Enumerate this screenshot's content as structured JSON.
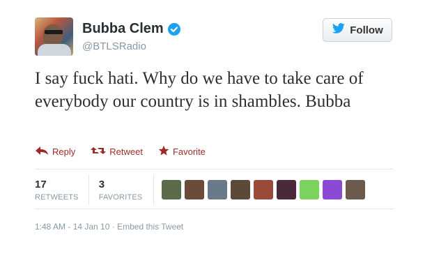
{
  "user": {
    "display_name": "Bubba Clem",
    "handle": "@BTLSRadio",
    "verified": true
  },
  "follow_button": {
    "label": "Follow",
    "icon": "twitter-bird-icon"
  },
  "tweet": {
    "text": "I say fuck hati. Why do we have to take care of everybody our country is in shambles. Bubba"
  },
  "actions": {
    "reply": "Reply",
    "retweet": "Retweet",
    "favorite": "Favorite"
  },
  "stats": {
    "retweets_count": "17",
    "retweets_label": "RETWEETS",
    "favorites_count": "3",
    "favorites_label": "FAVORITES"
  },
  "favoriters": [
    {
      "name": "favoriter-avatar-1",
      "color": "#5b6b4a"
    },
    {
      "name": "favoriter-avatar-2",
      "color": "#6b4b3a"
    },
    {
      "name": "favoriter-avatar-3",
      "color": "#6b7a8a"
    },
    {
      "name": "favoriter-avatar-4",
      "color": "#5a4a3a"
    },
    {
      "name": "favoriter-avatar-5",
      "color": "#9a4a3a"
    },
    {
      "name": "favoriter-avatar-6",
      "color": "#4a2a3a"
    },
    {
      "name": "favoriter-avatar-7",
      "color": "#7dd35f"
    },
    {
      "name": "favoriter-avatar-8",
      "color": "#8a4ad6"
    },
    {
      "name": "favoriter-avatar-9",
      "color": "#6d5a4f"
    }
  ],
  "meta": {
    "time": "1:48 AM - 14 Jan 10",
    "separator": "·",
    "embed": "Embed this Tweet"
  },
  "colors": {
    "verified": "#1da1f2",
    "action": "#9b2b2b",
    "muted": "#8899a6"
  }
}
